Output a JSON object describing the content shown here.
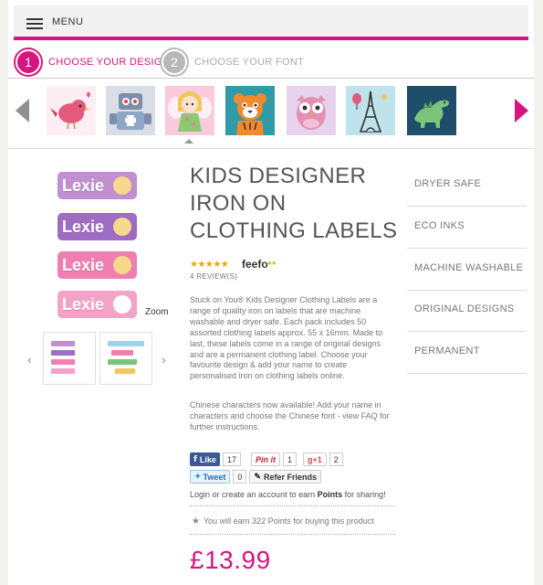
{
  "header": {
    "menu_label": "MENU"
  },
  "steps": [
    {
      "number": "1",
      "label": "CHOOSE YOUR DESIGN"
    },
    {
      "number": "2",
      "label": "CHOOSE YOUR FONT"
    }
  ],
  "carousel": {
    "designs": [
      {
        "name": "bird-design-icon"
      },
      {
        "name": "robot-design-icon"
      },
      {
        "name": "fairy-design-icon"
      },
      {
        "name": "tiger-design-icon"
      },
      {
        "name": "owl-design-icon"
      },
      {
        "name": "paris-design-icon"
      },
      {
        "name": "dinosaur-design-icon"
      }
    ]
  },
  "preview": {
    "label_name": "Lexie",
    "zoom_label": "Zoom",
    "prev_glyph": "‹",
    "next_glyph": "›"
  },
  "product": {
    "title": "KIDS DESIGNER IRON ON CLOTHING LABELS",
    "stars": "★★★★★",
    "rating_brand": "feefo",
    "reviews": "4 REVIEW(S)",
    "description": "Stuck on You® Kids Designer Clothing Labels are a range of quality iron on labels that are machine washable and dryer safe. Each pack includes 50 assorted clothing labels approx. 55 x 16mm. Made to last, these labels come in a range of original designs and are a permanent clothing label. Choose your favourite design & add your name to create personalised iron on clothing labels online.",
    "description2": "Chinese characters now available! Add your name in characters and choose the Chinese font - view FAQ for further instructions.",
    "price": "£13.99"
  },
  "social": {
    "like_label": "Like",
    "like_count": "17",
    "pin_label": "Pin it",
    "pin_count": "1",
    "gplus_label": "g+1",
    "gplus_count": "2",
    "tweet_label": "Tweet",
    "tweet_count": "0",
    "refer_label": "Refer Friends"
  },
  "points": {
    "login_text": "Login or create an account",
    "to_earn": " to earn ",
    "points_word": "Points",
    "for_sharing": " for sharing!",
    "earn_text": "You will earn 322 Points for buying this product"
  },
  "features": [
    "DRYER SAFE",
    "ECO INKS",
    "MACHINE WASHABLE",
    "ORIGINAL DESIGNS",
    "PERMANENT"
  ],
  "colors": {
    "accent": "#d6157e",
    "label_purple": "#b07fc4",
    "label_pink": "#ee87b6"
  }
}
